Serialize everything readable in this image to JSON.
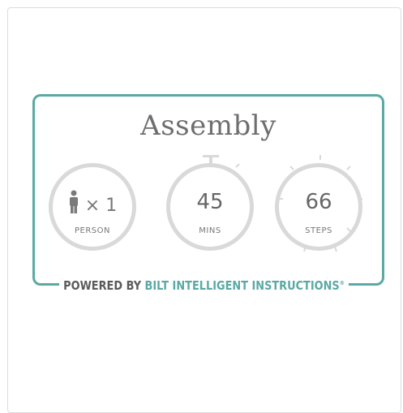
{
  "card": {
    "title": "Assembly",
    "people": {
      "icon": "person-icon",
      "count_text": "× 1",
      "label": "PERSON"
    },
    "time": {
      "value": "45",
      "label": "MINS"
    },
    "steps": {
      "value": "66",
      "label": "STEPS"
    },
    "footer": {
      "prefix": "POWERED BY",
      "brand": "BILT INTELLIGENT INSTRUCTIONS",
      "mark": "®"
    }
  },
  "colors": {
    "accent": "#5aa9a4",
    "dial_ring": "#d9d9d9",
    "text_gray": "#6e6e6e"
  }
}
